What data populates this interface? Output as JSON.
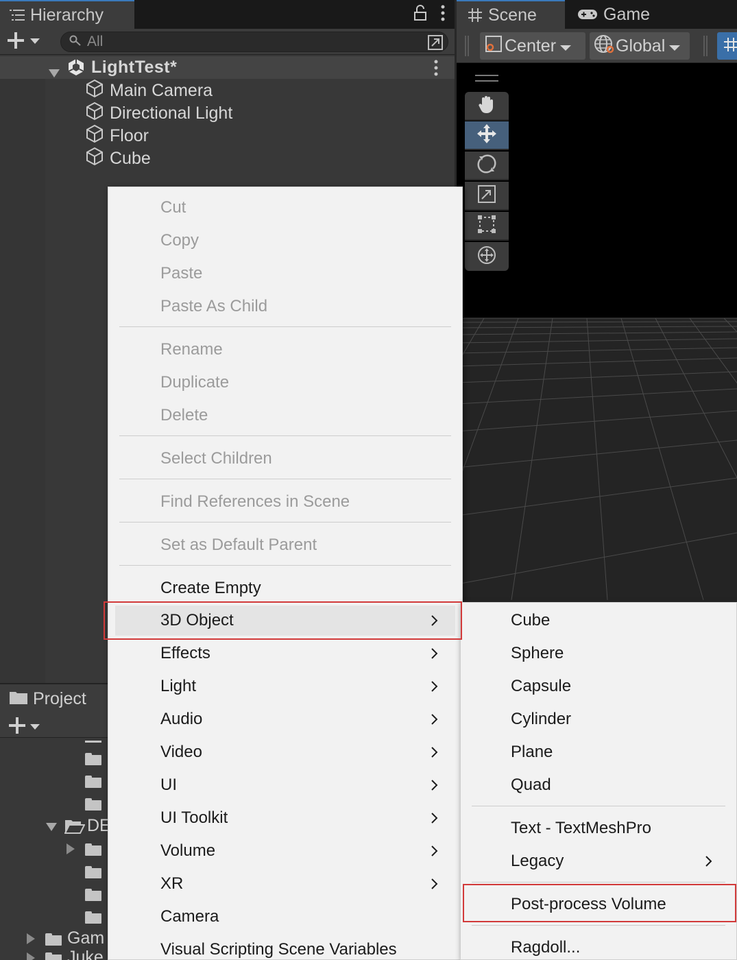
{
  "hierarchy": {
    "tab_label": "Hierarchy",
    "search_placeholder": "All",
    "scene": "LightTest*",
    "items": [
      "Main Camera",
      "Directional Light",
      "Floor",
      "Cube"
    ]
  },
  "scene_panel": {
    "tabs": [
      "Scene",
      "Game"
    ],
    "pivot_mode": "Center",
    "pivot_rotation": "Global",
    "tools": [
      "hand-tool",
      "move-tool",
      "rotate-tool",
      "scale-tool",
      "rect-tool",
      "transform-tool"
    ],
    "active_tool": "move-tool"
  },
  "project": {
    "tab_label": "Project",
    "folder_partial_1": "DE",
    "folder_partial_2": "Gam",
    "folder_partial_3": "Juke"
  },
  "context_menu": {
    "items": [
      {
        "label": "Cut",
        "enabled": false
      },
      {
        "label": "Copy",
        "enabled": false
      },
      {
        "label": "Paste",
        "enabled": false
      },
      {
        "label": "Paste As Child",
        "enabled": false
      },
      {
        "label": "Rename",
        "enabled": false
      },
      {
        "label": "Duplicate",
        "enabled": false
      },
      {
        "label": "Delete",
        "enabled": false
      },
      {
        "label": "Select Children",
        "enabled": false
      },
      {
        "label": "Find References in Scene",
        "enabled": false
      },
      {
        "label": "Set as Default Parent",
        "enabled": false
      },
      {
        "label": "Create Empty",
        "enabled": true
      },
      {
        "label": "3D Object",
        "enabled": true,
        "submenu": true,
        "highlighted": true
      },
      {
        "label": "Effects",
        "enabled": true,
        "submenu": true
      },
      {
        "label": "Light",
        "enabled": true,
        "submenu": true
      },
      {
        "label": "Audio",
        "enabled": true,
        "submenu": true
      },
      {
        "label": "Video",
        "enabled": true,
        "submenu": true
      },
      {
        "label": "UI",
        "enabled": true,
        "submenu": true
      },
      {
        "label": "UI Toolkit",
        "enabled": true,
        "submenu": true
      },
      {
        "label": "Volume",
        "enabled": true,
        "submenu": true
      },
      {
        "label": "XR",
        "enabled": true,
        "submenu": true
      },
      {
        "label": "Camera",
        "enabled": true
      },
      {
        "label": "Visual Scripting Scene Variables",
        "enabled": true
      }
    ]
  },
  "submenu_3d_object": {
    "items": [
      {
        "label": "Cube"
      },
      {
        "label": "Sphere"
      },
      {
        "label": "Capsule"
      },
      {
        "label": "Cylinder"
      },
      {
        "label": "Plane"
      },
      {
        "label": "Quad"
      },
      {
        "label": "Text - TextMeshPro"
      },
      {
        "label": "Legacy",
        "submenu": true
      },
      {
        "label": "Post-process Volume",
        "highlighted": true
      },
      {
        "label": "Ragdoll..."
      }
    ]
  },
  "colors": {
    "editor_bg": "#383838",
    "menu_bg": "#f2f2f2",
    "highlight_box": "#d23a3a",
    "active_tool": "#46607c"
  }
}
